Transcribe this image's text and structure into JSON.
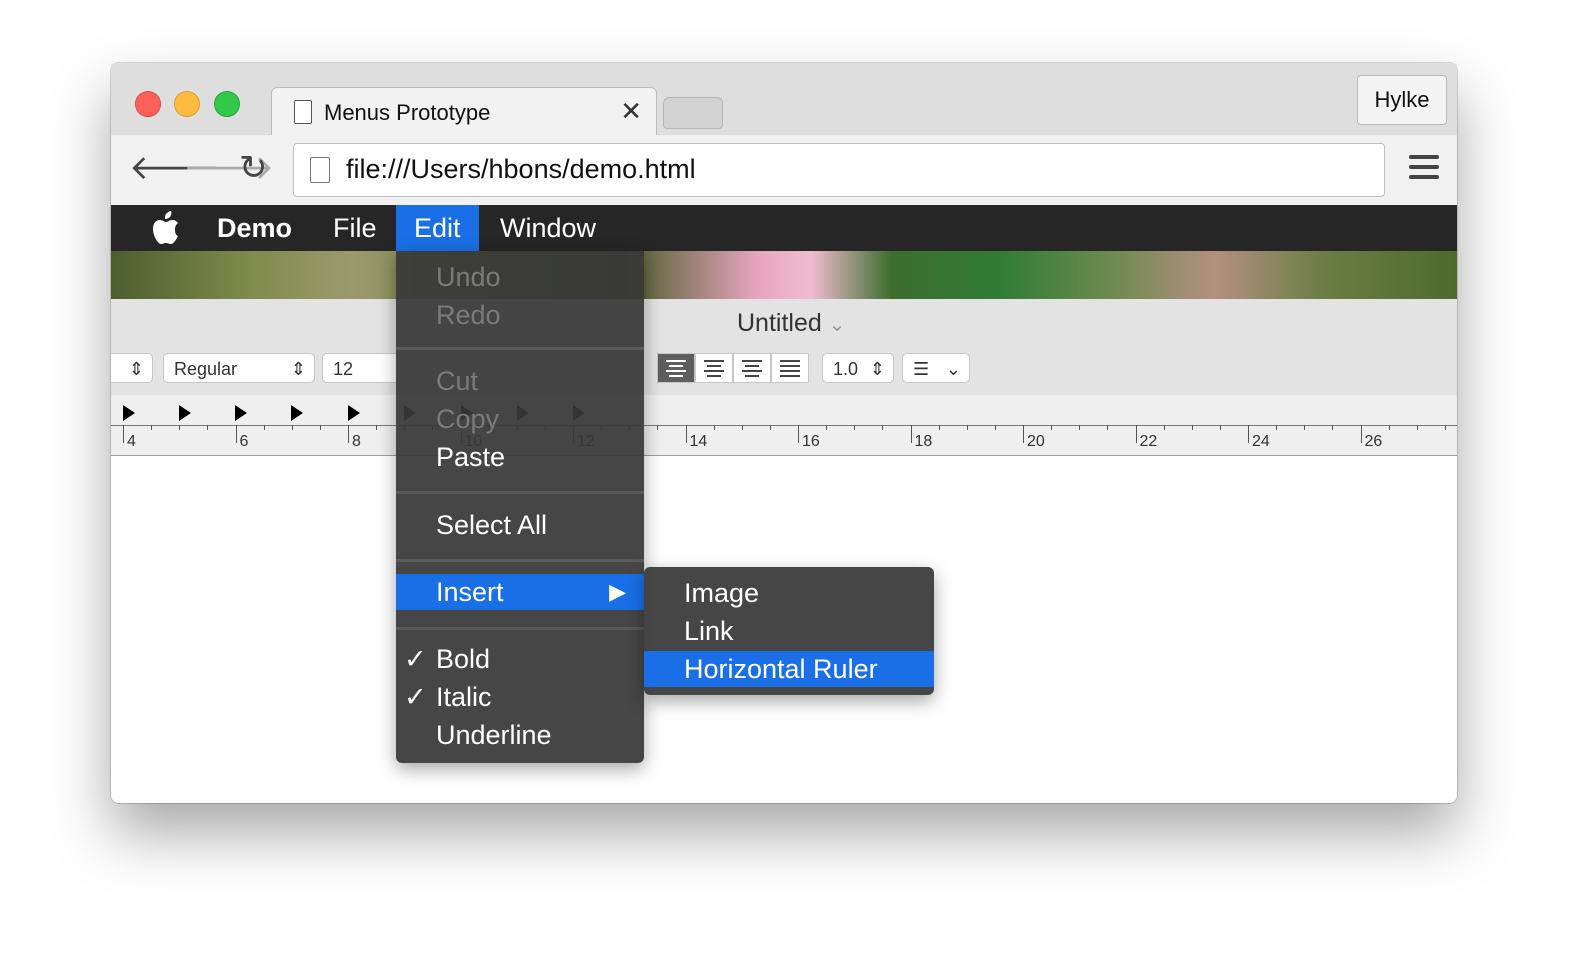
{
  "tab": {
    "title": "Menus Prototype",
    "close": "✕"
  },
  "profile": {
    "name": "Hylke"
  },
  "address": {
    "url": "file:///Users/hbons/demo.html"
  },
  "nav": {
    "back": "🡐",
    "forward": "🡒",
    "reload": "↻"
  },
  "menubar": {
    "apple": "",
    "items": [
      "Demo",
      "File",
      "Edit",
      "Window"
    ],
    "active": "Edit"
  },
  "document": {
    "title": "Untitled",
    "title_chevron": "⌄"
  },
  "format": {
    "style": "Regular",
    "size": "12",
    "spacing": "1.0"
  },
  "ruler": {
    "numbers": [
      "4",
      "6",
      "8",
      "10",
      "12",
      "14",
      "16",
      "18",
      "20",
      "22",
      "24",
      "26"
    ]
  },
  "edit_menu": {
    "undo": "Undo",
    "redo": "Redo",
    "cut": "Cut",
    "copy": "Copy",
    "paste": "Paste",
    "select_all": "Select All",
    "insert": "Insert",
    "insert_arrow": "▶",
    "bold": "Bold",
    "italic": "Italic",
    "underline": "Underline",
    "checkmark": "✓"
  },
  "insert_submenu": {
    "image": "Image",
    "link": "Link",
    "horizontal_ruler": "Horizontal Ruler"
  },
  "colors": {
    "accent": "#1a6fe6",
    "menubar": "#262626",
    "menu_bg": "#383838"
  }
}
